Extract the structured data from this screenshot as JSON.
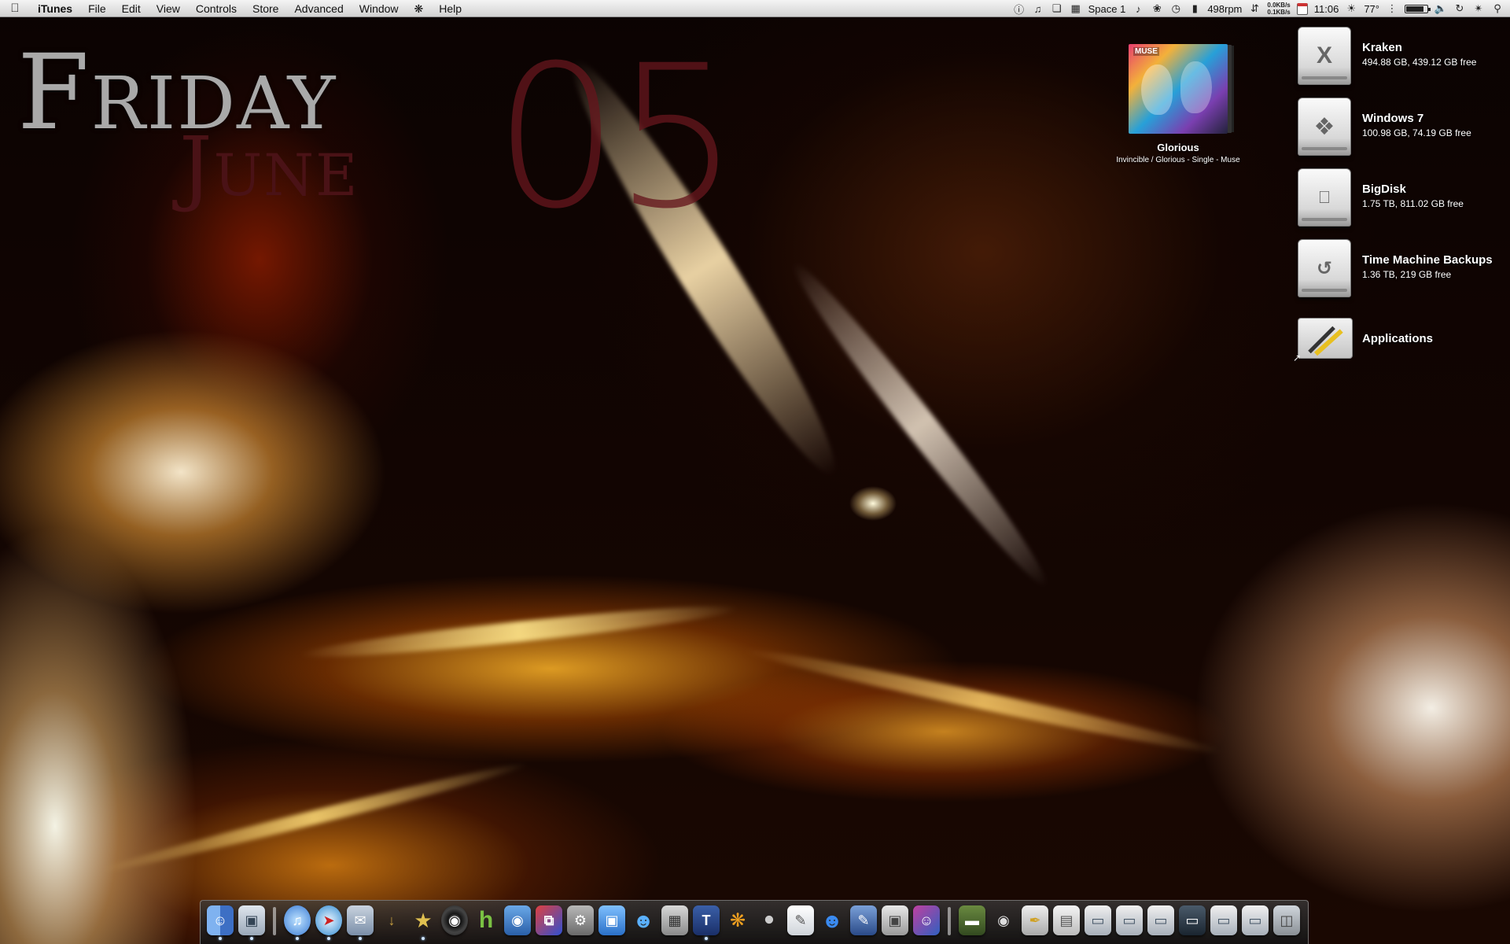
{
  "menubar": {
    "app_name": "iTunes",
    "items": [
      "File",
      "Edit",
      "View",
      "Controls",
      "Store",
      "Advanced",
      "Window",
      "Help"
    ],
    "space_label": "Space 1",
    "fan_speed": "498rpm",
    "net_up": "0.0KB/s",
    "net_down": "0.1KB/s",
    "clock": "11:06",
    "temperature": "77°",
    "battery_fraction": 0.8
  },
  "date_widget": {
    "day": "Friday",
    "month": "June",
    "date": "05"
  },
  "now_playing": {
    "artwork_label": "MUSE",
    "title": "Glorious",
    "subtitle": "Invincible / Glorious - Single - Muse"
  },
  "desktop_icons": [
    {
      "name": "Kraken",
      "info": "494.88 GB, 439.12 GB free",
      "icon": "x-drive-icon"
    },
    {
      "name": "Windows 7",
      "info": "100.98 GB, 74.19 GB free",
      "icon": "windows-drive-icon"
    },
    {
      "name": "BigDisk",
      "info": "1.75 TB, 811.02 GB free",
      "icon": "apple-drive-icon"
    },
    {
      "name": "Time Machine Backups",
      "info": "1.36 TB, 219 GB free",
      "icon": "time-machine-drive-icon"
    },
    {
      "name": "Applications",
      "info": "",
      "icon": "applications-folder-icon"
    }
  ],
  "dock": {
    "colors": {
      "finder": "#5a8fd8",
      "itunes": "#3a7bd5",
      "safari": "#2f8ad1",
      "mail": "#7a8ea8",
      "hulu": "#7ac143",
      "trash": "#9aa0a6"
    }
  },
  "colors": {
    "date_day": "#a9a9a9",
    "date_month": "#4a1216",
    "date_number": "#64161c"
  }
}
